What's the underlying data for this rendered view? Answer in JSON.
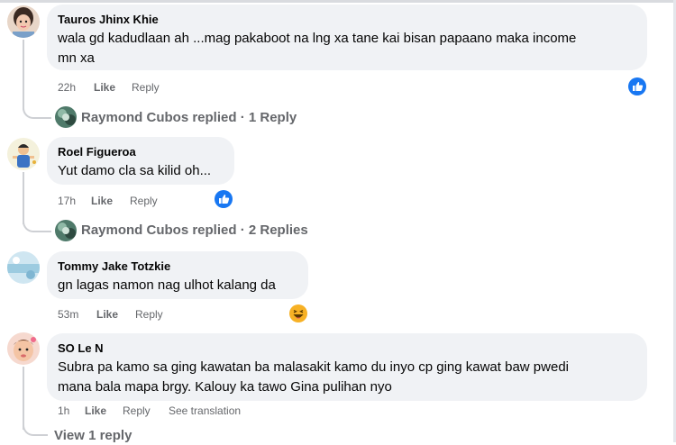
{
  "comments": [
    {
      "author": "Tauros Jhinx Khie",
      "text_line1": "wala gd kadudlaan ah ...mag pakaboot na lng xa tane kai bisan papaano maka income",
      "text_line2": "mn xa",
      "time": "22h",
      "like_label": "Like",
      "reply_label": "Reply",
      "reaction": "like-reaction",
      "replies_author": "Raymond Cubos",
      "replies_text": "Raymond Cubos replied · 1 Reply"
    },
    {
      "author": "Roel Figueroa",
      "text_line1": "Yut damo cla sa kilid oh...",
      "time": "17h",
      "like_label": "Like",
      "reply_label": "Reply",
      "reaction": "like-reaction",
      "replies_author": "Raymond Cubos",
      "replies_text": "Raymond Cubos replied · 2 Replies"
    },
    {
      "author": "Tommy Jake Totzkie",
      "text_line1": "gn lagas namon nag ulhot kalang da",
      "time": "53m",
      "like_label": "Like",
      "reply_label": "Reply",
      "reaction": "haha-reaction"
    },
    {
      "author": "SO Le N",
      "text_line1": "Subra pa kamo sa ging kawatan ba malasakit kamo du inyo cp ging kawat baw pwedi",
      "text_line2": "mana bala mapa brgy. Kalouy ka tawo Gina pulihan nyo",
      "time": "1h",
      "like_label": "Like",
      "reply_label": "Reply",
      "translate_label": "See translation",
      "view_replies": "View 1 reply"
    }
  ],
  "colors": {
    "bubble": "#f0f2f5",
    "meta": "#65676b",
    "like_blue": "#1877f2",
    "haha_yellow": "#f7b125"
  }
}
